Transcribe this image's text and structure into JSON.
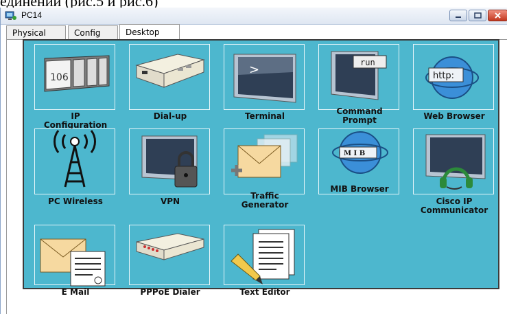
{
  "document_caption": "единений (рис.5 и рис.6)",
  "window": {
    "title": "PC14",
    "controls": [
      "minimize-icon",
      "maximize-icon",
      "close-icon"
    ]
  },
  "tabs": [
    {
      "label": "Physical",
      "active": false
    },
    {
      "label": "Config",
      "active": false
    },
    {
      "label": "Desktop",
      "active": true
    }
  ],
  "desktop": {
    "background_color": "#4db7ce",
    "apps": [
      {
        "label": "IP\nConfiguration",
        "icon": "ip-configuration-icon",
        "icon_text": "106"
      },
      {
        "label": "Dial-up",
        "icon": "modem-icon"
      },
      {
        "label": "Terminal",
        "icon": "terminal-icon",
        "icon_text": ">"
      },
      {
        "label": "Command\nPrompt",
        "icon": "command-prompt-icon",
        "icon_text": "run"
      },
      {
        "label": "Web Browser",
        "icon": "web-browser-icon",
        "icon_text": "http:"
      },
      {
        "label": "PC Wireless",
        "icon": "wireless-antenna-icon"
      },
      {
        "label": "VPN",
        "icon": "vpn-lock-icon"
      },
      {
        "label": "Traffic\nGenerator",
        "icon": "traffic-generator-icon"
      },
      {
        "label": "MIB Browser",
        "icon": "mib-browser-icon",
        "icon_text": "M I B"
      },
      {
        "label": "Cisco IP\nCommunicator",
        "icon": "headset-monitor-icon"
      },
      {
        "label": "E Mail",
        "icon": "email-icon"
      },
      {
        "label": "PPPoE Dialer",
        "icon": "pppoe-dialer-icon"
      },
      {
        "label": "Text Editor",
        "icon": "text-editor-icon"
      }
    ]
  }
}
